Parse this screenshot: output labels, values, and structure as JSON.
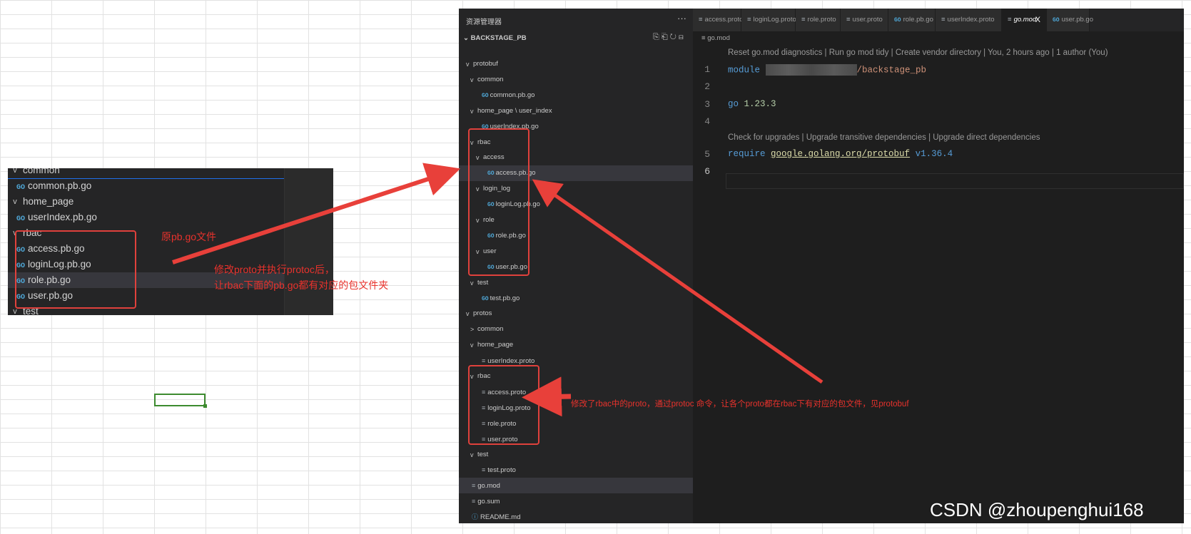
{
  "mini_explorer": {
    "rows": [
      {
        "label": "common",
        "chevron": "v"
      },
      {
        "label": "common.pb.go",
        "icon": "GO"
      },
      {
        "label": "home_page",
        "chevron": "v"
      },
      {
        "label": "userIndex.pb.go",
        "icon": "GO"
      },
      {
        "label": "rbac",
        "chevron": "v"
      },
      {
        "label": "access.pb.go",
        "icon": "GO"
      },
      {
        "label": "loginLog.pb.go",
        "icon": "GO"
      },
      {
        "label": "role.pb.go",
        "icon": "GO"
      },
      {
        "label": "user.pb.go",
        "icon": "GO"
      },
      {
        "label": "test",
        "chevron": "v"
      }
    ]
  },
  "annotations": {
    "original": "原pb.go文件",
    "modified_line1": "修改proto并执行protoc后，",
    "modified_line2": "让rbac下面的pb.go都有对应的包文件夹",
    "protos_note": "修改了rbac中的proto，通过protoc 命令，让各个proto都在rbac下有对应的包文件，见protobuf"
  },
  "explorer": {
    "title": "资源管理器",
    "more": "···",
    "project": "BACKSTAGE_PB",
    "tree": [
      {
        "label": "protobuf",
        "chevron": "v",
        "indent": 0
      },
      {
        "label": "common",
        "chevron": "v",
        "indent": 1
      },
      {
        "label": "common.pb.go",
        "icon": "go",
        "indent": 2
      },
      {
        "label": "home_page \\ user_index",
        "chevron": "v",
        "indent": 1
      },
      {
        "label": "userIndex.pb.go",
        "icon": "go",
        "indent": 2
      },
      {
        "label": "rbac",
        "chevron": "v",
        "indent": 1
      },
      {
        "label": "access",
        "chevron": "v",
        "indent": 2
      },
      {
        "label": "access.pb.go",
        "icon": "go",
        "indent": 3
      },
      {
        "label": "login_log",
        "chevron": "v",
        "indent": 2
      },
      {
        "label": "loginLog.pb.go",
        "icon": "go",
        "indent": 3
      },
      {
        "label": "role",
        "chevron": "v",
        "indent": 2
      },
      {
        "label": "role.pb.go",
        "icon": "go",
        "indent": 3
      },
      {
        "label": "user",
        "chevron": "v",
        "indent": 2
      },
      {
        "label": "user.pb.go",
        "icon": "go",
        "indent": 3
      },
      {
        "label": "test",
        "chevron": "v",
        "indent": 1
      },
      {
        "label": "test.pb.go",
        "icon": "go",
        "indent": 2
      },
      {
        "label": "protos",
        "chevron": "v",
        "indent": 0
      },
      {
        "label": "common",
        "chevron": ">",
        "indent": 1
      },
      {
        "label": "home_page",
        "chevron": "v",
        "indent": 1
      },
      {
        "label": "userIndex.proto",
        "icon": "lines",
        "indent": 2
      },
      {
        "label": "rbac",
        "chevron": "v",
        "indent": 1
      },
      {
        "label": "access.proto",
        "icon": "lines",
        "indent": 2
      },
      {
        "label": "loginLog.proto",
        "icon": "lines",
        "indent": 2
      },
      {
        "label": "role.proto",
        "icon": "lines",
        "indent": 2
      },
      {
        "label": "user.proto",
        "icon": "lines",
        "indent": 2
      },
      {
        "label": "test",
        "chevron": "v",
        "indent": 1
      },
      {
        "label": "test.proto",
        "icon": "lines",
        "indent": 2
      },
      {
        "label": "go.mod",
        "icon": "lines",
        "indent": 0
      },
      {
        "label": "go.sum",
        "icon": "lines",
        "indent": 0
      },
      {
        "label": "README.md",
        "icon": "info",
        "indent": 0
      }
    ]
  },
  "tabs": [
    {
      "label": "access.proto",
      "icon": "lines"
    },
    {
      "label": "loginLog.proto",
      "icon": "lines"
    },
    {
      "label": "role.proto",
      "icon": "lines"
    },
    {
      "label": "user.proto",
      "icon": "lines"
    },
    {
      "label": "role.pb.go",
      "icon": "go"
    },
    {
      "label": "userIndex.proto",
      "icon": "lines"
    },
    {
      "label": "go.mod",
      "icon": "lines",
      "active": true,
      "close": "X"
    },
    {
      "label": "user.pb.go",
      "icon": "go"
    }
  ],
  "editor": {
    "breadcrumb": "go.mod",
    "codelens1": "Reset go.mod diagnostics | Run go mod tidy | Create vendor directory | You, 2 hours ago | 1 author (You)",
    "codelens2": "Check for upgrades | Upgrade transitive dependencies | Upgrade direct dependencies",
    "line_numbers": [
      "1",
      "2",
      "3",
      "4",
      "5",
      "6"
    ],
    "module_kw": "module",
    "module_path": "/backstage_pb",
    "go_kw": "go",
    "go_version": "1.23.3",
    "require_kw": "require",
    "require_pkg": "google.golang.org/protobuf",
    "require_ver": "v1.36.4"
  },
  "watermark": "CSDN @zhoupenghui168"
}
